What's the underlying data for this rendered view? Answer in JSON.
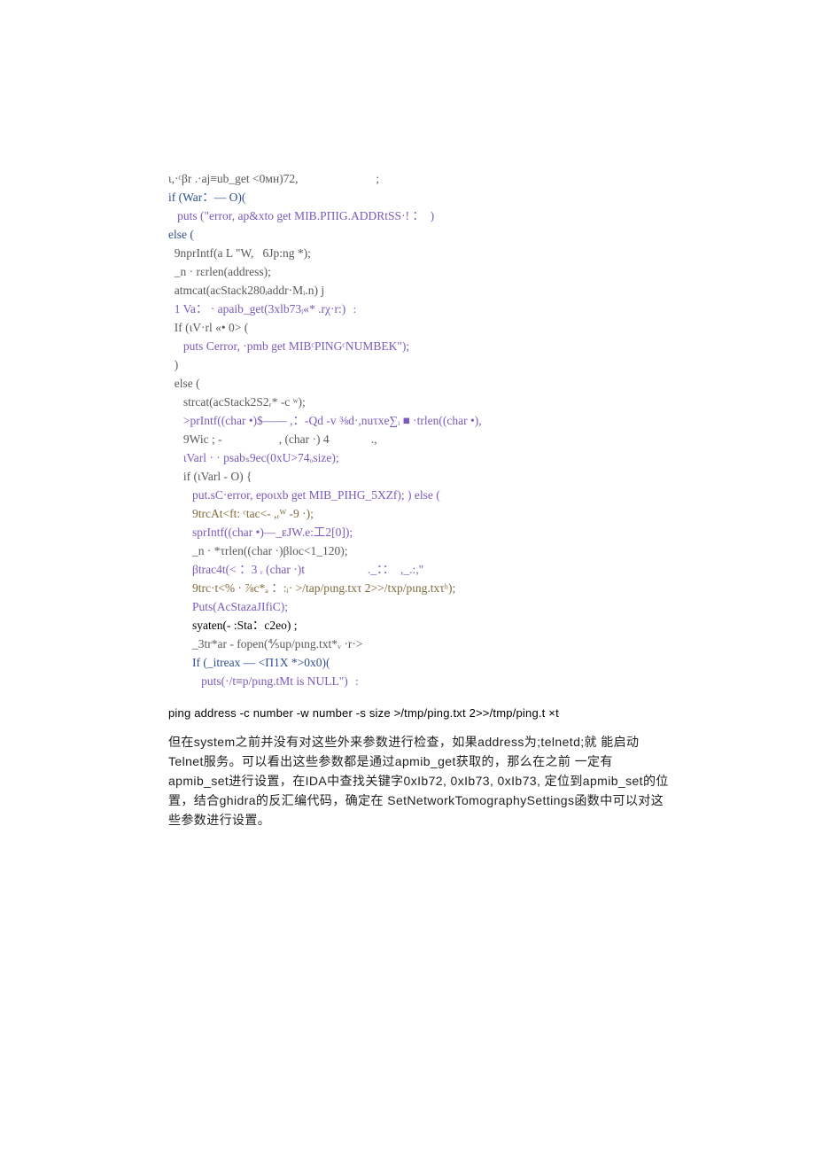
{
  "code": {
    "l1": "ι,·ᶜβr .·aj≡ub_get <0ᴍн)72,                          ;",
    "l2_a": "if (War：— O)(",
    "l3_a": "   puts (\"error, ap&xto get MIB.PΠΙG.ADDRtSS·! ：  )",
    "l4_a": "else (",
    "l5": "  9nprIntf(a L \"W,   6Jp:ng *);",
    "l6": "  _n · rεrlen(address);",
    "l7": "  atmcat(acStack280ᵢaddr·Mᵢ.n) j",
    "l8_a": "  1 Va： · apaib_get(3xlb73ᵢ«* .rχ·r:) ﹕",
    "l9": "  If (ιV·rl «• 0> (",
    "l10_a": "     puts Cerror, ·pmb get MIBᶜPINGᶜNUMBEK\");",
    "l11": "  )",
    "l12": "  else (",
    "l13": "     strcat(acStack2S2ᵣ* -c ʷ);",
    "l14_a": "     >prIntf((char •)$—— ,：-Qd -v ⅜d·,nuτxe∑ᵢ ■ ·trlen((char •),",
    "l15": "     9Wic ; -                   , (char ·) 4              .,",
    "l16_a": "     ιVarl · · psabₛ9ec(0xU>74ₒsize);",
    "l17": "     if (ιVarl - O) {",
    "l18_a": "        put.sC·error, epoιxb get MIB_PIHG_5XZf); ) else (",
    "l19": "        9trcAt<ft: ᶜtac<- ,ᵣᵂ -9 ·);",
    "l20_a": "        sprIntf((char •)—_ᴇJW.e:工2[0]);",
    "l21": "        _n · *τrlen((char ·)βloc<1_120);",
    "l22_a": "        βtrac4t(< ：3 ᵣ (char ·)t                     ._：：  ,_.:,\"",
    "l23_a": "        9trc·t<% · ⅞c*ₐ ：:ᵢ· >/tap/pιng.txτ 2>>/txp/pιng.txτʰ);",
    "l24_a": "        Puts(AcStazaJIfiC);",
    "l25_a": "        syaten(- :Sta：c2eo) ;",
    "l26": "        _3tr*ar - fopen(⅘up/pιng.txt*ᵥ ·r·>",
    "l27_a": "        If (_itreax — <Π1X *>0x0)(",
    "l28_a": "           puts(·/t≡p/pιng.tMt is NULL\") ﹕"
  },
  "cmdline": "ping address -c number -w number -s size >/tmp/ping.txt 2>>/tmp/ping.t ×t",
  "paragraph": "但在system之前并没有对这些外来参数进行检查，如果address为;telnetd;就   能启动Telnet服务。可以看出这些参数都是通过apmib_get获取的，那么在之前   一定有apmib_set进行设置，在IDA中查找关键字0xIb72, 0xIb73, 0xIb73, 定位到apmib_set的位置，结合ghidra的反汇编代码，确定在 SetNetworkTomographySettings函数中可以对这些参数进行设置。"
}
